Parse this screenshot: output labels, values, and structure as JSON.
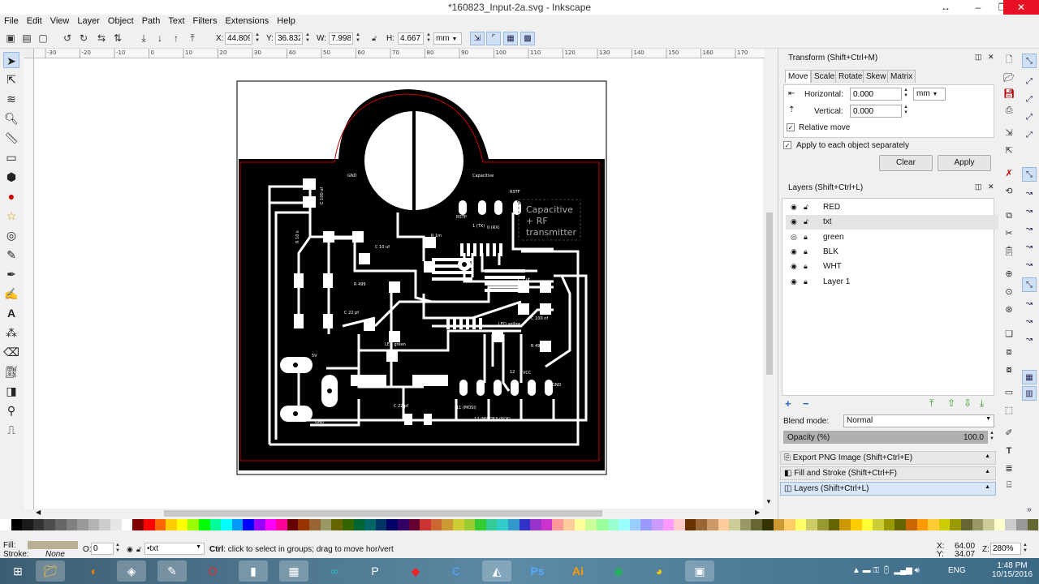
{
  "window": {
    "title": "*160823_Input-2a.svg - Inkscape"
  },
  "menu": [
    "File",
    "Edit",
    "View",
    "Layer",
    "Object",
    "Path",
    "Text",
    "Filters",
    "Extensions",
    "Help"
  ],
  "toolbar": {
    "x_label": "X:",
    "x_value": "44.809",
    "y_label": "Y:",
    "y_value": "36.832",
    "w_label": "W:",
    "w_value": "7.998",
    "h_label": "H:",
    "h_value": "4.667",
    "unit": "mm"
  },
  "ruler": {
    "marks": [
      "-30",
      "-20",
      "-10",
      "0",
      "10",
      "20",
      "30",
      "40",
      "50",
      "60",
      "70",
      "80",
      "90",
      "100",
      "110",
      "120",
      "130",
      "140",
      "150",
      "160",
      "170"
    ]
  },
  "transform": {
    "title": "Transform (Shift+Ctrl+M)",
    "tabs": [
      "Move",
      "Scale",
      "Rotate",
      "Skew",
      "Matrix"
    ],
    "horizontal_label": "Horizontal:",
    "horizontal_value": "0.000",
    "unit": "mm",
    "vertical_label": "Vertical:",
    "vertical_value": "0.000",
    "relative_move": "Relative move",
    "apply_each": "Apply to each object separately",
    "clear": "Clear",
    "apply": "Apply"
  },
  "layers": {
    "title": "Layers (Shift+Ctrl+L)",
    "items": [
      {
        "name": "RED"
      },
      {
        "name": "txt",
        "selected": true
      },
      {
        "name": "green"
      },
      {
        "name": "BLK"
      },
      {
        "name": "WHT"
      },
      {
        "name": "Layer 1"
      }
    ],
    "blend_label": "Blend mode:",
    "blend_value": "Normal",
    "opacity_label": "Opacity (%)",
    "opacity_value": "100.0",
    "opacity_fraction": 1.0
  },
  "docks": [
    "Export PNG Image (Shift+Ctrl+E)",
    "Fill and Stroke (Shift+Ctrl+F)",
    "Layers (Shift+Ctrl+L)"
  ],
  "board": {
    "labels": {
      "gnd": "GND",
      "capacitive": "Capacitive",
      "rstf": "RSTF",
      "rstp": "RSTP",
      "tx": "1\n(TX)",
      "rx": "0\n(RX)",
      "c100uf": "C 100 uf",
      "r10k": "R 10 k",
      "c10uf": "C 10 uf",
      "r1m": "R 1m",
      "r499a": "R 499",
      "c22pfa": "C 22 pf",
      "c1uf": "C 1 uf",
      "c100nf": "C 100 nf",
      "ledyellow": "LED yellow",
      "r499b": "R 499",
      "ledgreen": "LED green",
      "v5": "5V",
      "n12": "12",
      "vcc": "VCC",
      "gnd2": "GND",
      "c22pfb": "C 22 pf",
      "miso": "11\n(MOSI)",
      "sck": "12     13\n(MISO)  (SCK)",
      "gnd3": "GND"
    },
    "selected_text": [
      "Capacitive",
      "+ RF",
      "transmitter"
    ]
  },
  "status": {
    "fill_label": "Fill:",
    "stroke_label": "Stroke:",
    "stroke_value": "None",
    "opacity_label": "O:",
    "opacity_value": "0",
    "layer_value": "•txt",
    "hint_key": "Ctrl",
    "hint": ": click to select in groups; drag to move hor/vert",
    "x_label": "X:",
    "x_value": "64.00",
    "y_label": "Y:",
    "y_value": "34.07",
    "z_label": "Z:",
    "zoom": "280%"
  },
  "taskbar": {
    "lang": "ENG",
    "time": "1:48 PM",
    "date": "10/15/2016"
  },
  "colors": {
    "selection_blue": "#cfe0f5",
    "board_black": "#000000",
    "outline_red": "#c00000"
  }
}
